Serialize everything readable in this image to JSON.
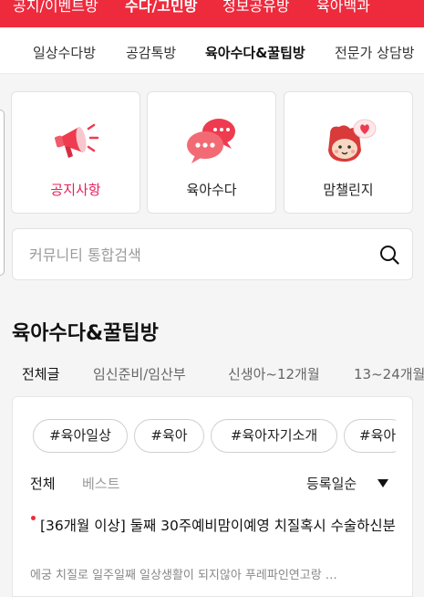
{
  "top_nav": [
    "공지/이벤트방",
    "수다/고민방",
    "정보공유방",
    "육아백과"
  ],
  "sub_nav": [
    "일상수다방",
    "공감톡방",
    "육아수다&꿀팁방",
    "전문가 상담방"
  ],
  "cards": [
    {
      "label": "공지사항",
      "icon": "megaphone-icon"
    },
    {
      "label": "육아수다",
      "icon": "chat-bubbles-icon"
    },
    {
      "label": "맘챌린지",
      "icon": "heart-character-icon"
    }
  ],
  "search": {
    "placeholder": "커뮤니티 통합검색"
  },
  "section_title": "육아수다&꿀팁방",
  "category_tabs": [
    "전체글",
    "임신준비/임산부",
    "신생아~12개월",
    "13~24개월"
  ],
  "tags": [
    "#육아일상",
    "#육아",
    "#육아자기소개",
    "#육아"
  ],
  "filter": {
    "all": "전체",
    "best": "베스트",
    "sort": "등록일순"
  },
  "post": {
    "title": "[36개월 이상] 둘째 30주예비맘이예영 치질혹시 수술하신분",
    "excerpt": "에궁 치질로 일주일째 일상생활이 되지않아 푸레파인연고랑 …"
  },
  "colors": {
    "accent": "#ee2a3d",
    "notice_label": "#e5215a"
  }
}
